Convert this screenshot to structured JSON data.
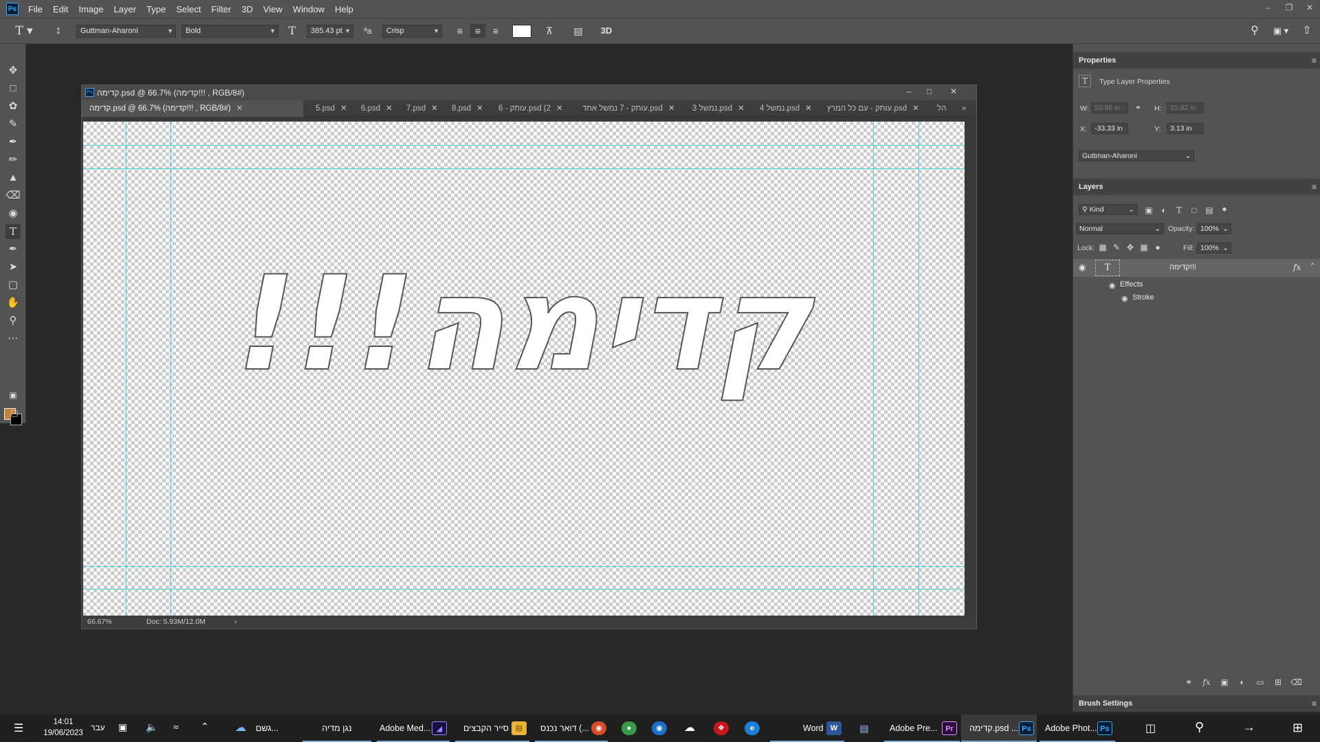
{
  "app": {
    "logo": "Ps",
    "menu": [
      "File",
      "Edit",
      "Image",
      "Layer",
      "Type",
      "Select",
      "Filter",
      "3D",
      "View",
      "Window",
      "Help"
    ]
  },
  "options": {
    "font_family": "Guttman-Aharoni",
    "font_style": "Bold",
    "font_size": "385.43 pt",
    "anti_alias": "Crisp",
    "three_d": "3D",
    "text_color": "#ffffff"
  },
  "tools": {
    "foreground_color": "#c9822f",
    "background_color": "#000000"
  },
  "document": {
    "title": "קדימה.psd @ 66.7% (קדימה!!!      , RGB/8#)",
    "tabs": [
      {
        "label": "קדימה.psd @ 66.7% (קדימה!!!      , RGB/8#)"
      },
      {
        "label": "5.psd"
      },
      {
        "label": "6.psd"
      },
      {
        "label": "7.psd"
      },
      {
        "label": "8.psd"
      },
      {
        "label": "עותק - 6.psd (2"
      },
      {
        "label": "עותק - 7 נמשל אחד.psd"
      },
      {
        "label": "נמשל 3.psd"
      },
      {
        "label": "נמשל 4.psd"
      },
      {
        "label": "עותק - עם כל המרץ.psd"
      },
      {
        "label": "הל"
      }
    ],
    "canvas_text": "קדימה!!!",
    "zoom": "66.67%",
    "doc_size": "Doc: 5.93M/12.0M"
  },
  "properties": {
    "title": "Properties",
    "subtitle": "Type Layer Properties",
    "w_label": "W:",
    "w_value": "55.86 in",
    "h_label": "H:",
    "h_value": "15.82 in",
    "x_label": "X:",
    "x_value": "-33.33 in",
    "y_label": "Y:",
    "y_value": "3.13 in",
    "font": "Guttman-Aharoni"
  },
  "layers": {
    "title": "Layers",
    "filter_kind": "Kind",
    "blend_mode": "Normal",
    "opacity_label": "Opacity:",
    "opacity": "100%",
    "lock_label": "Lock:",
    "fill_label": "Fill:",
    "fill": "100%",
    "layer_name": "קדימה!!!",
    "fx": "fx",
    "effects_label": "Effects",
    "stroke_label": "Stroke"
  },
  "brush_settings": {
    "title": "Brush Settings"
  },
  "taskbar": {
    "time": "14:01",
    "date": "19/06/2023",
    "language": "עבר",
    "weather": "גשם...",
    "items": [
      {
        "label": "נגן מדיה"
      },
      {
        "label": "Adobe Med..."
      },
      {
        "label": "סייר הקבצים"
      },
      {
        "label": "דואר נכנס (..."
      },
      {
        "label": "Word"
      },
      {
        "label": "Adobe Pre..."
      },
      {
        "label": "קדימה.psd ..."
      },
      {
        "label": "Adobe Phot..."
      }
    ],
    "icons": {
      "ps": "Ps",
      "pr": "Pr",
      "w": "W"
    }
  }
}
